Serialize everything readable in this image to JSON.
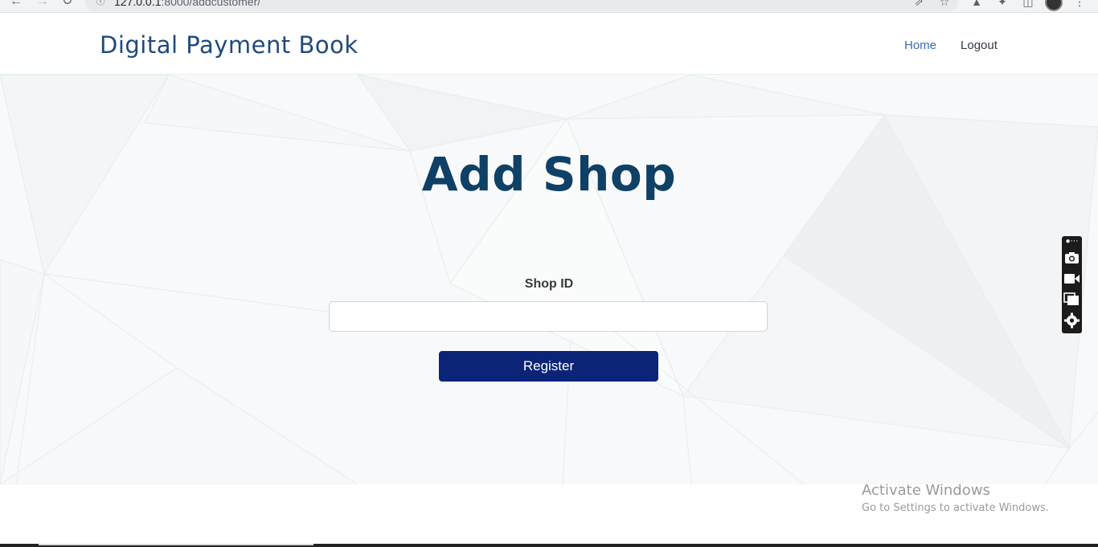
{
  "browser": {
    "url_host": "127.0.0.1",
    "url_rest": ":8000/addcustomer/"
  },
  "navbar": {
    "brand": "Digital Payment Book",
    "links": [
      {
        "label": "Home"
      },
      {
        "label": "Logout"
      }
    ]
  },
  "page": {
    "title": "Add Shop",
    "form": {
      "shop_id_label": "Shop ID",
      "shop_id_value": "",
      "submit_label": "Register"
    }
  },
  "watermark": {
    "line1": "Activate Windows",
    "line2": "Go to Settings to activate Windows."
  },
  "colors": {
    "brand": "#1e4a7c",
    "title": "#0f4066",
    "button": "#0b2478",
    "nav_active": "#3a6fb0"
  },
  "icons": {
    "side_toolbar": [
      "camera-icon",
      "video-icon",
      "copy-icon",
      "gear-icon"
    ]
  }
}
